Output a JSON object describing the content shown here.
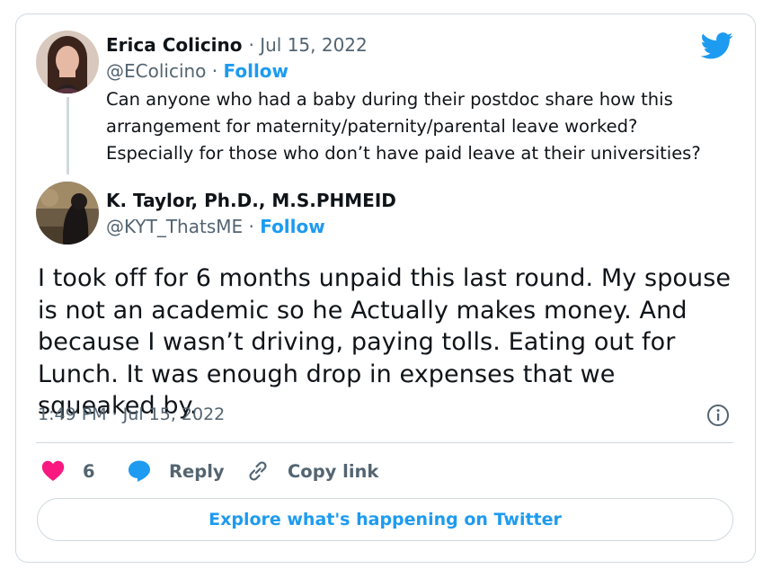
{
  "quoted_tweet": {
    "author_name": "Erica Colicino",
    "date": "· Jul 15, 2022",
    "handle": "@EColicino",
    "separator": "·",
    "follow_label": "Follow",
    "text": "Can anyone who had a baby during their postdoc share how this arrangement for maternity/paternity/parental leave worked? Especially for those who don’t have paid leave at their universities?"
  },
  "main_tweet": {
    "author_name": "K. Taylor, Ph.D., M.S.PHMEID",
    "handle": "@KYT_ThatsME",
    "separator": "·",
    "follow_label": "Follow",
    "text": "I took off for 6 months unpaid this last round. My spouse is not an academic so he Actually makes money. And because I wasn’t driving, paying tolls. Eating out for Lunch. It was enough drop in expenses that we squeaked by.",
    "timestamp": "1:49 PM · Jul 15, 2022"
  },
  "actions": {
    "like_count": "6",
    "reply_label": "Reply",
    "copy_link_label": "Copy link"
  },
  "explore_label": "Explore what's happening on Twitter",
  "icons": {
    "brand": "twitter-bird-icon",
    "info": "info-icon",
    "like": "heart-icon",
    "reply": "speech-bubble-icon",
    "copy": "link-icon"
  },
  "colors": {
    "accent": "#1d9bf0",
    "like": "#f91880",
    "border": "#cfd9de",
    "muted": "#536471",
    "text": "#0f1419"
  }
}
